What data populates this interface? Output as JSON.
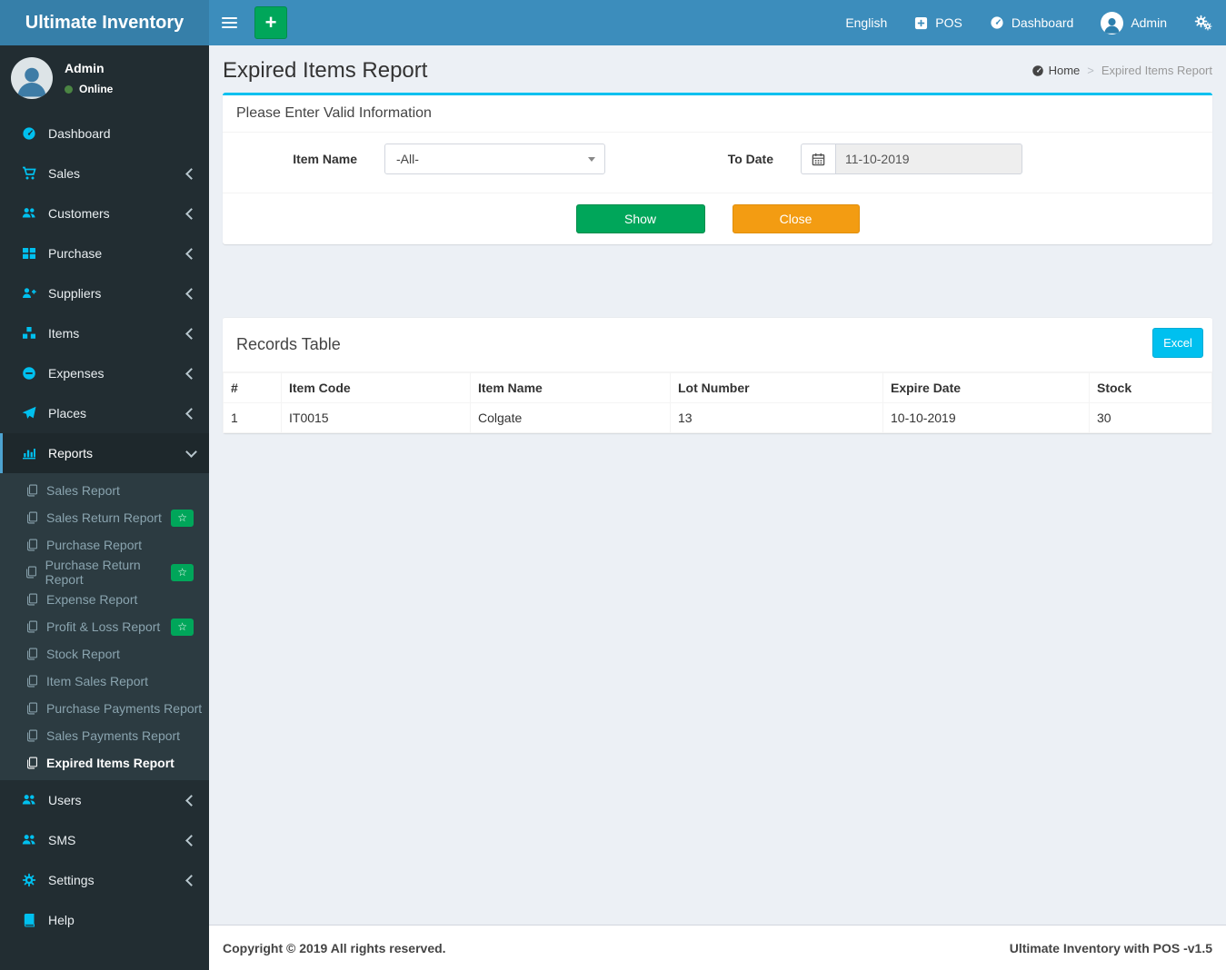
{
  "colors": {
    "navbar": "#3c8dbc",
    "logo_bg": "#367fa9",
    "sidebar_bg": "#222d32",
    "submenu_bg": "#2c3b41",
    "sidebar_icon": "#00c0ef",
    "active_border": "#4da3d1",
    "panel_top_border": "#00c0ef",
    "green": "#00a65a",
    "orange": "#f39c12",
    "excel_blue": "#00c0ef",
    "online_dot": "#4b8543"
  },
  "header": {
    "brand": "Ultimate Inventory",
    "quick_add": "+",
    "nav": {
      "language": "English",
      "pos": "POS",
      "dashboard": "Dashboard",
      "user": "Admin"
    }
  },
  "sidebar": {
    "user": {
      "name": "Admin",
      "status": "Online"
    },
    "badge_star": "☆",
    "items": [
      {
        "label": "Dashboard"
      },
      {
        "label": "Sales"
      },
      {
        "label": "Customers"
      },
      {
        "label": "Purchase"
      },
      {
        "label": "Suppliers"
      },
      {
        "label": "Items"
      },
      {
        "label": "Expenses"
      },
      {
        "label": "Places"
      }
    ],
    "reports": {
      "label": "Reports",
      "children": [
        {
          "label": "Sales Report"
        },
        {
          "label": "Sales Return Report",
          "badge": true
        },
        {
          "label": "Purchase Report"
        },
        {
          "label": "Purchase Return Report",
          "badge": true
        },
        {
          "label": "Expense Report"
        },
        {
          "label": "Profit & Loss Report",
          "badge": true
        },
        {
          "label": "Stock Report"
        },
        {
          "label": "Item Sales Report"
        },
        {
          "label": "Purchase Payments Report"
        },
        {
          "label": "Sales Payments Report"
        },
        {
          "label": "Expired Items Report",
          "active": true
        }
      ]
    },
    "items_bottom": [
      {
        "label": "Users"
      },
      {
        "label": "SMS"
      },
      {
        "label": "Settings"
      },
      {
        "label": "Help"
      }
    ]
  },
  "page": {
    "title": "Expired Items Report",
    "breadcrumb": {
      "home": "Home",
      "separator": ">",
      "current": "Expired Items Report"
    }
  },
  "filter_panel": {
    "heading": "Please Enter Valid Information",
    "item_name_label": "Item Name",
    "item_name_value": "-All-",
    "to_date_label": "To Date",
    "to_date_value": "11-10-2019",
    "show_button": "Show",
    "close_button": "Close"
  },
  "records_panel": {
    "heading": "Records Table",
    "excel_button": "Excel",
    "table": {
      "columns": [
        "#",
        "Item Code",
        "Item Name",
        "Lot Number",
        "Expire Date",
        "Stock"
      ],
      "rows": [
        [
          "1",
          "IT0015",
          "Colgate",
          "13",
          "10-10-2019",
          "30"
        ]
      ]
    }
  },
  "footer": {
    "left": "Copyright © 2019 All rights reserved.",
    "right": "Ultimate Inventory with POS -v1.5"
  }
}
